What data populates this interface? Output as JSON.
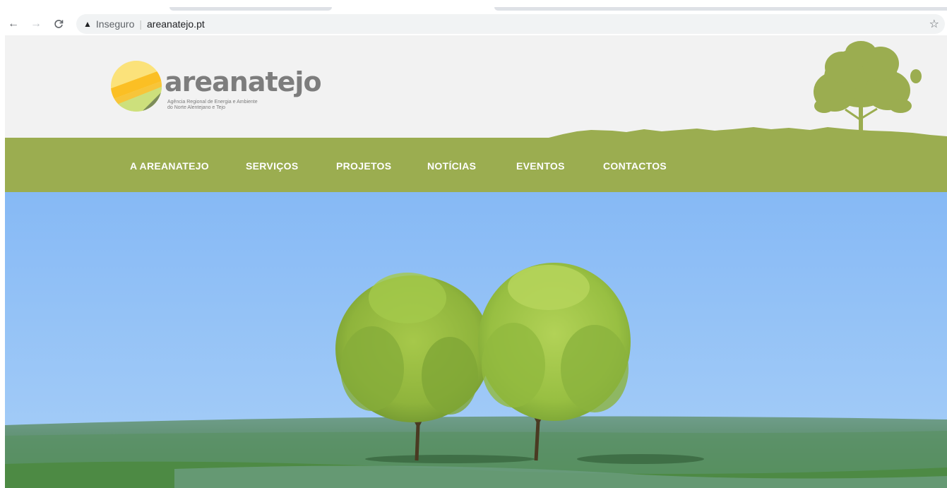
{
  "browser": {
    "back_icon": "arrow-left-icon",
    "forward_icon": "arrow-right-icon",
    "reload_icon": "reload-icon",
    "security_icon": "warning-triangle-icon",
    "security_label": "Inseguro",
    "separator": "|",
    "url": "areanatejo.pt",
    "bookmark_icon": "star-icon"
  },
  "site": {
    "logo": {
      "name": "areanatejo",
      "tagline_line1": "Agência Regional de Energia e Ambiente",
      "tagline_line2": "do Norte Alentejano e Tejo"
    },
    "nav": [
      {
        "label": "A AREANATEJO"
      },
      {
        "label": "SERVIÇOS"
      },
      {
        "label": "PROJETOS"
      },
      {
        "label": "NOTÍCIAS"
      },
      {
        "label": "EVENTOS"
      },
      {
        "label": "CONTACTOS"
      }
    ]
  },
  "colors": {
    "nav_green": "#9bad50",
    "header_gray": "#f2f2f2",
    "tree_green": "#9bad50",
    "sky_blue": "#8ebdf3"
  }
}
